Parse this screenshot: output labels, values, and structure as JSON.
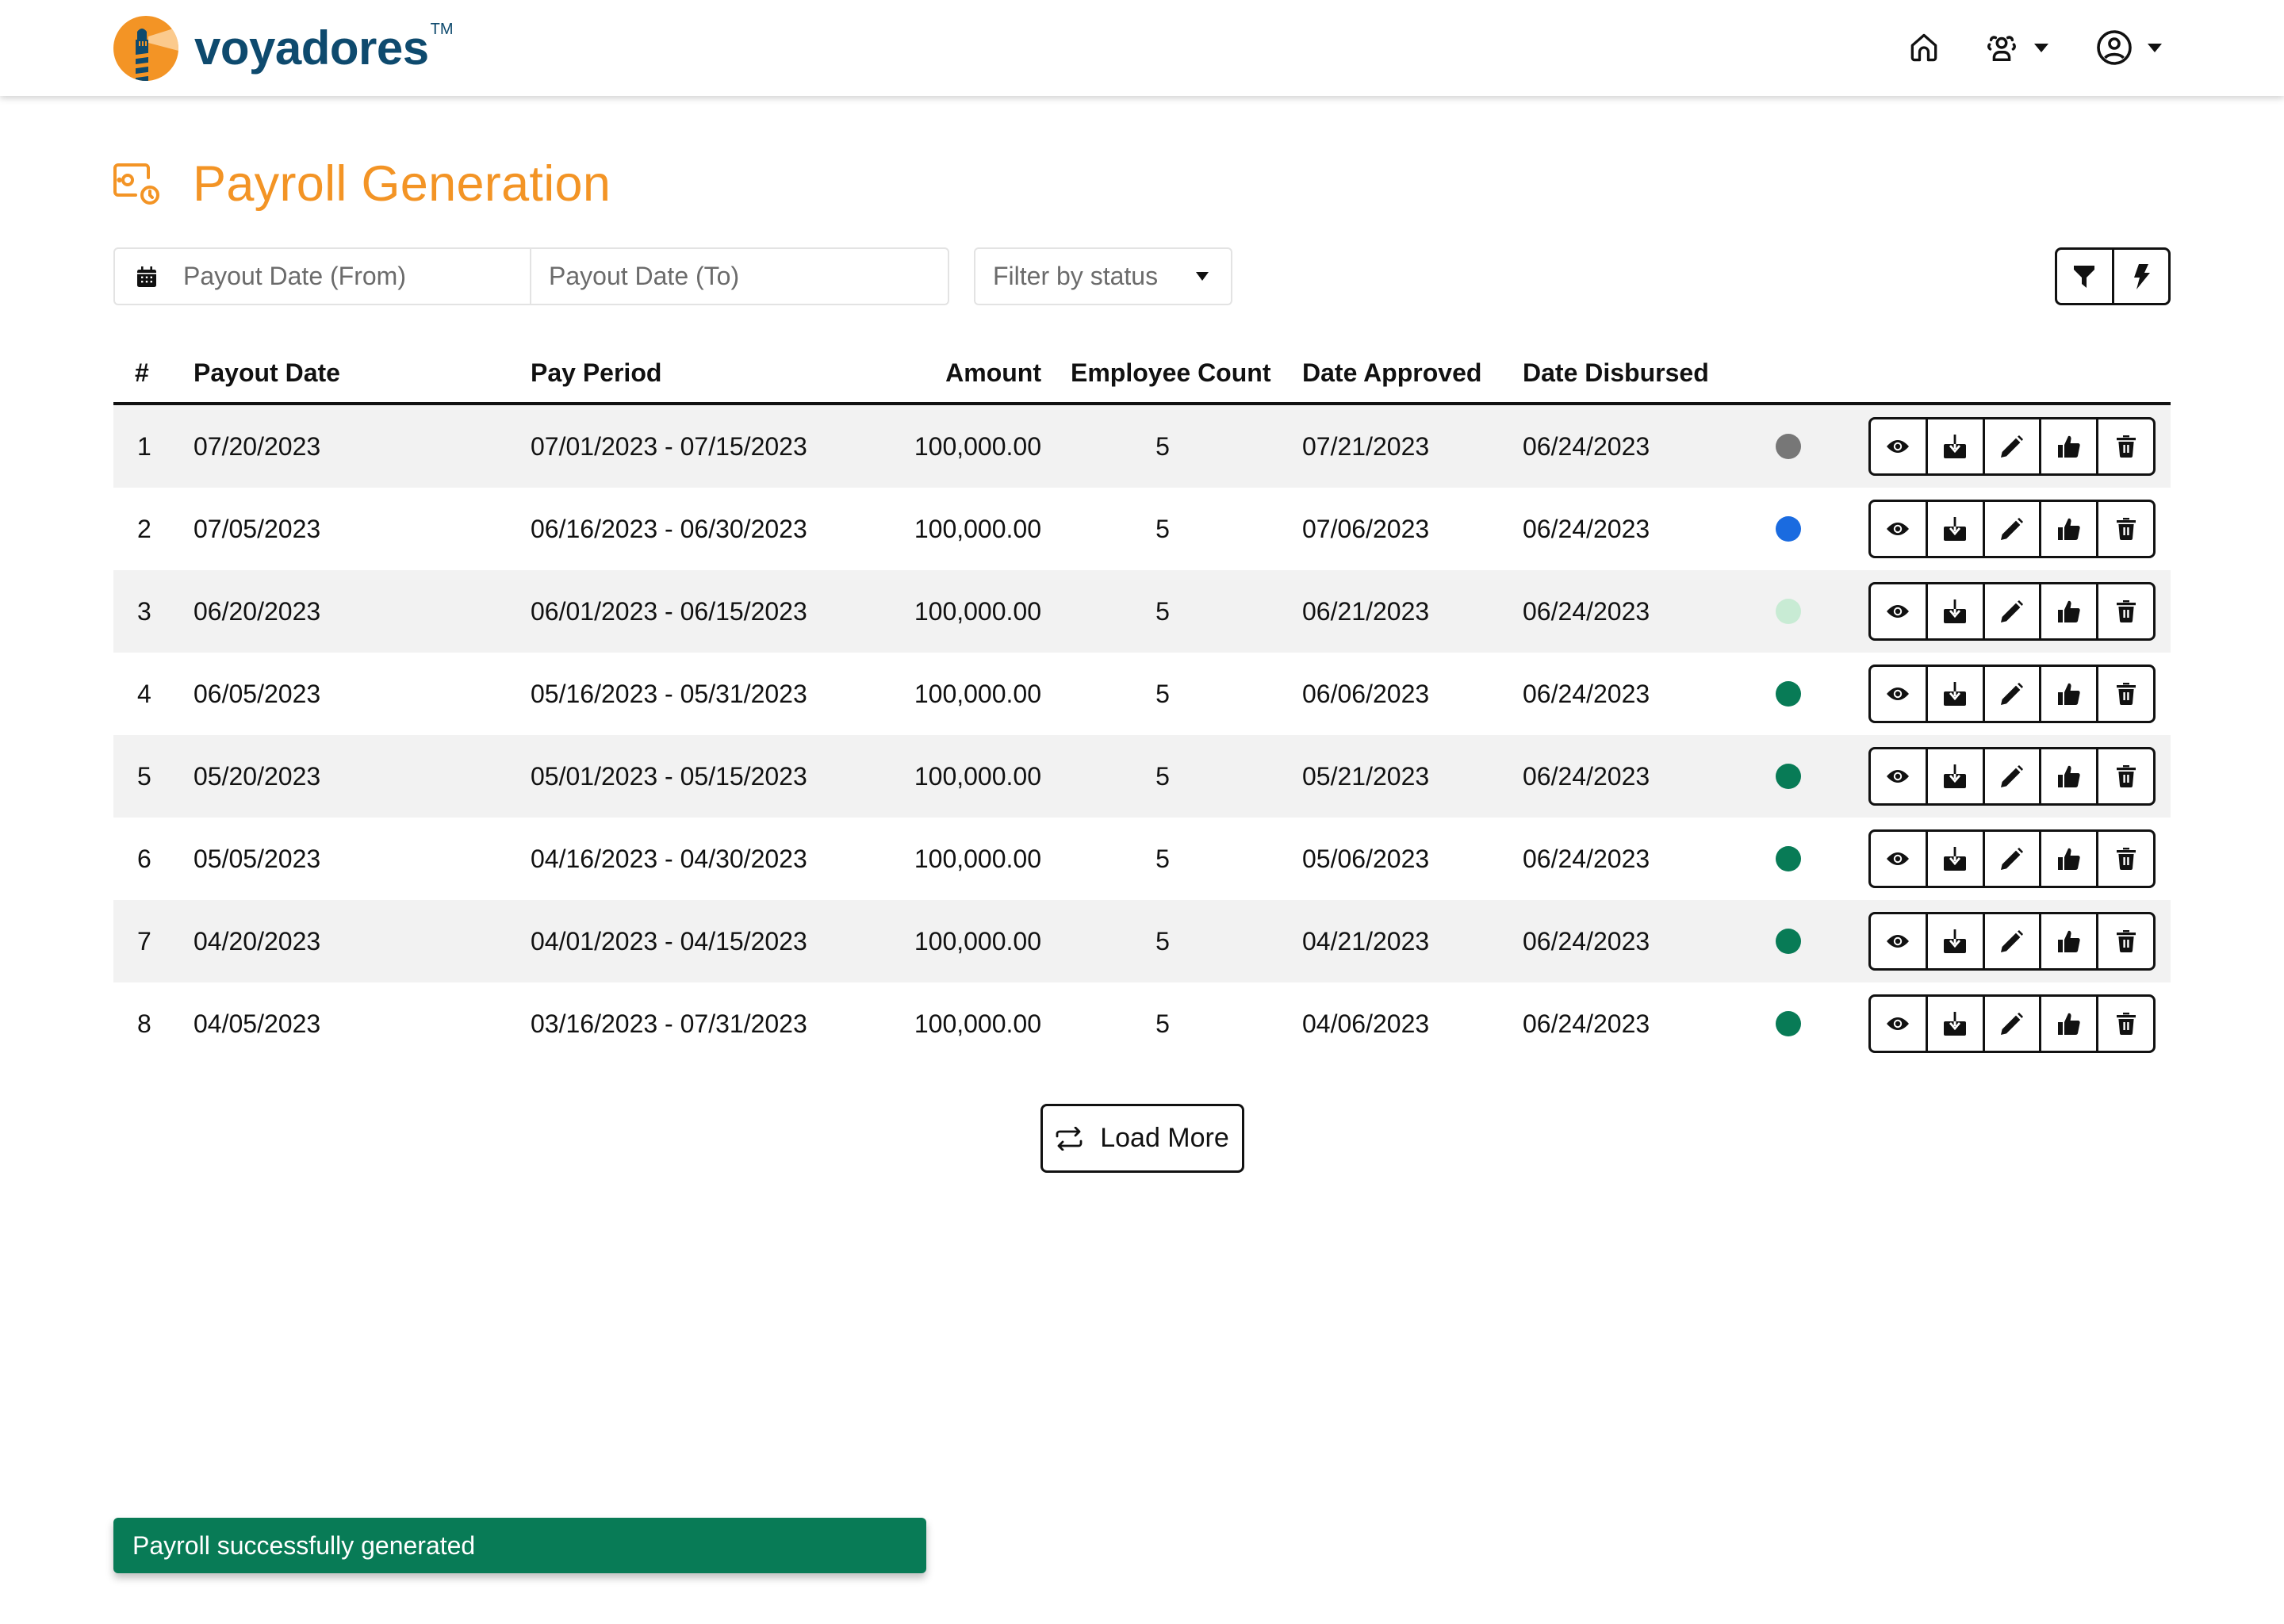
{
  "brand": {
    "name": "voyadores",
    "trademark": "TM"
  },
  "nav": {
    "icons": [
      "home-icon",
      "users-icon",
      "user-circle-icon"
    ]
  },
  "page": {
    "title": "Payroll Generation",
    "icon": "payroll-icon"
  },
  "filters": {
    "date_from_placeholder": "Payout Date (From)",
    "date_to_placeholder": "Payout Date (To)",
    "status_placeholder": "Filter by status",
    "tools": [
      "filter-icon",
      "bolt-icon"
    ]
  },
  "table": {
    "headers": {
      "num": "#",
      "payout_date": "Payout Date",
      "pay_period": "Pay Period",
      "amount": "Amount",
      "employee_count": "Employee Count",
      "date_approved": "Date Approved",
      "date_disbursed": "Date Disbursed"
    },
    "rows": [
      {
        "num": "1",
        "payout_date": "07/20/2023",
        "pay_period": "07/01/2023 - 07/15/2023",
        "amount": "100,000.00",
        "employee_count": "5",
        "date_approved": "07/21/2023",
        "date_disbursed": "06/24/2023",
        "status_color": "#777777"
      },
      {
        "num": "2",
        "payout_date": "07/05/2023",
        "pay_period": "06/16/2023 - 06/30/2023",
        "amount": "100,000.00",
        "employee_count": "5",
        "date_approved": "07/06/2023",
        "date_disbursed": "06/24/2023",
        "status_color": "#1A6BE0"
      },
      {
        "num": "3",
        "payout_date": "06/20/2023",
        "pay_period": "06/01/2023 - 06/15/2023",
        "amount": "100,000.00",
        "employee_count": "5",
        "date_approved": "06/21/2023",
        "date_disbursed": "06/24/2023",
        "status_color": "#C8EBD4"
      },
      {
        "num": "4",
        "payout_date": "06/05/2023",
        "pay_period": "05/16/2023 - 05/31/2023",
        "amount": "100,000.00",
        "employee_count": "5",
        "date_approved": "06/06/2023",
        "date_disbursed": "06/24/2023",
        "status_color": "#087B56"
      },
      {
        "num": "5",
        "payout_date": "05/20/2023",
        "pay_period": "05/01/2023 - 05/15/2023",
        "amount": "100,000.00",
        "employee_count": "5",
        "date_approved": "05/21/2023",
        "date_disbursed": "06/24/2023",
        "status_color": "#087B56"
      },
      {
        "num": "6",
        "payout_date": "05/05/2023",
        "pay_period": "04/16/2023 - 04/30/2023",
        "amount": "100,000.00",
        "employee_count": "5",
        "date_approved": "05/06/2023",
        "date_disbursed": "06/24/2023",
        "status_color": "#087B56"
      },
      {
        "num": "7",
        "payout_date": "04/20/2023",
        "pay_period": "04/01/2023 - 04/15/2023",
        "amount": "100,000.00",
        "employee_count": "5",
        "date_approved": "04/21/2023",
        "date_disbursed": "06/24/2023",
        "status_color": "#087B56"
      },
      {
        "num": "8",
        "payout_date": "04/05/2023",
        "pay_period": "03/16/2023 - 07/31/2023",
        "amount": "100,000.00",
        "employee_count": "5",
        "date_approved": "04/06/2023",
        "date_disbursed": "06/24/2023",
        "status_color": "#087B56"
      }
    ],
    "row_actions": [
      "view",
      "download",
      "edit",
      "approve",
      "delete"
    ]
  },
  "load_more": {
    "label": "Load More"
  },
  "toast": {
    "message": "Payroll successfully generated",
    "color": "#087B56"
  },
  "colors": {
    "brand_orange": "#F39425",
    "brand_navy": "#0E4A6E",
    "success": "#087B56"
  }
}
